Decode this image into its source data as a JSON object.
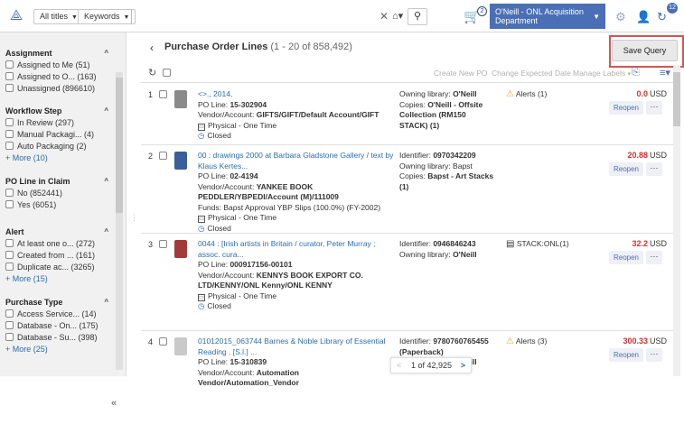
{
  "topbar": {
    "scope_label": "All titles",
    "field_label": "Keywords",
    "search_value": "",
    "cart_count": "2",
    "institution": "O'Neill - ONL Acquisition Department",
    "notifications": "12"
  },
  "sidebar": {
    "facets": [
      {
        "title": "Assignment",
        "items": [
          "Assigned to Me (51)",
          "Assigned to O... (163)",
          "Unassigned (896610)"
        ],
        "more": ""
      },
      {
        "title": "Workflow Step",
        "items": [
          "In Review (297)",
          "Manual Packagi... (4)",
          "Auto Packaging (2)"
        ],
        "more": "+ More (10)"
      },
      {
        "title": "PO Line in Claim",
        "items": [
          "No (852441)",
          "Yes (6051)"
        ],
        "more": ""
      },
      {
        "title": "Alert",
        "items": [
          "At least one o... (272)",
          "Created from ... (161)",
          "Duplicate ac... (3265)"
        ],
        "more": "+ More (15)"
      },
      {
        "title": "Purchase Type",
        "items": [
          "Access Service... (14)",
          "Database - On... (175)",
          "Database - Su... (398)"
        ],
        "more": "+ More (25)"
      }
    ],
    "collapse": "«"
  },
  "main": {
    "title": "Purchase Order Lines",
    "count": "(1 - 20 of 858,492)",
    "save_query": "Save Query",
    "actions": {
      "create": "Create New PO",
      "change_date": "Change Expected Date",
      "manage_labels": "Manage Labels"
    },
    "rows": [
      {
        "num": "1",
        "title": "<>., 2014,",
        "line1": "PO Line: ",
        "line1b": "15-302904",
        "line2": "Vendor/Account: ",
        "line2b": "GIFTS/GIFT/Default Account/GIFT",
        "line3": "",
        "line3b": "",
        "type": "Physical - One Time",
        "status": "Closed",
        "mid1": "Owning library: ",
        "mid1b": "O'Neill",
        "mid2": "Copies: ",
        "mid2b": "O'Neill - Offsite Collection (RM150 STACK) (1)",
        "alert": "Alerts (1)",
        "price": "0.0",
        "cur": "USD",
        "reopen": "Reopen",
        "thumb_color": "#8a8a8a"
      },
      {
        "num": "2",
        "title": "00 : drawings 2000 at Barbara Gladstone Gallery / text by Klaus Kertes...",
        "line1": "PO Line: ",
        "line1b": "02-4194",
        "line2": "Vendor/Account: ",
        "line2b": "YANKEE BOOK PEDDLER/YBPEDI/Account (M)/111009",
        "line3": "Funds: Bapst Approval YBP Slips (100.0%) (FY-2002)",
        "line3b": "",
        "type": "Physical - One Time",
        "status": "Closed",
        "mid1": "Identifier: ",
        "mid1b": "0970342209",
        "mid2": "Owning library: Bapst",
        "mid2b": "",
        "mid3": "Copies: ",
        "mid3b": "Bapst - Art Stacks (1)",
        "alert": "",
        "price": "20.88",
        "cur": "USD",
        "reopen": "Reopen",
        "thumb_color": "#3a5f9a"
      },
      {
        "num": "3",
        "title": "0044 : [Irish artists in Britain / curator, Peter Murray ; assoc. cura...",
        "line1": "PO Line: ",
        "line1b": "000917156-00101",
        "line2": "Vendor/Account: ",
        "line2b": "KENNYS BOOK EXPORT CO. LTD/KENNY/ONL Kenny/ONL KENNY",
        "line3": "",
        "line3b": "",
        "type": "Physical - One Time",
        "status": "Closed",
        "mid1": "Identifier: ",
        "mid1b": "0946846243",
        "mid2": "Owning library: ",
        "mid2b": "O'Neill",
        "alert": "STACK:ONL(1)",
        "price": "32.2",
        "cur": "USD",
        "reopen": "Reopen",
        "thumb_color": "#a33a3a"
      },
      {
        "num": "4",
        "title": "01012015_063744 Barnes & Noble Library of Essential Reading . [S.l.] ...",
        "line1": "PO Line: ",
        "line1b": "15-310839",
        "line2": "Vendor/Account: ",
        "line2b": "Automation Vendor/Automation_Vendor",
        "line3": "",
        "line3b": "",
        "type": "",
        "status": "",
        "mid1": "Identifier: ",
        "mid1b": "9780760765455 (Paperback)",
        "mid2": "Owning library: ",
        "mid2b": "O'Neill",
        "alert": "Alerts (3)",
        "price": "300.33",
        "cur": "USD",
        "reopen": "Reopen",
        "thumb_color": "#c9c9c9"
      }
    ],
    "pager": {
      "text": "1 of 42,925",
      "prev": "<",
      "next": ">"
    }
  }
}
